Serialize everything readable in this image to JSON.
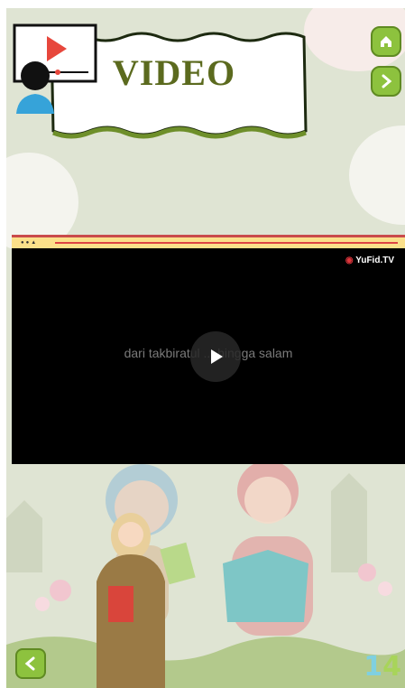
{
  "header": {
    "title": "VIDEO"
  },
  "nav": {
    "home_icon": "home-icon",
    "next_icon": "chevron-right-icon",
    "prev_icon": "chevron-left-icon"
  },
  "video": {
    "brand": "YuFid.TV",
    "subtitle": "dari takbiratul ... hingga salam",
    "play_icon": "play-icon"
  },
  "page_number": {
    "digit1": "1",
    "digit2": "4"
  },
  "colors": {
    "accent_green": "#8dc23e",
    "title_olive": "#5b6a1e",
    "bg": "#dfe4d3"
  }
}
